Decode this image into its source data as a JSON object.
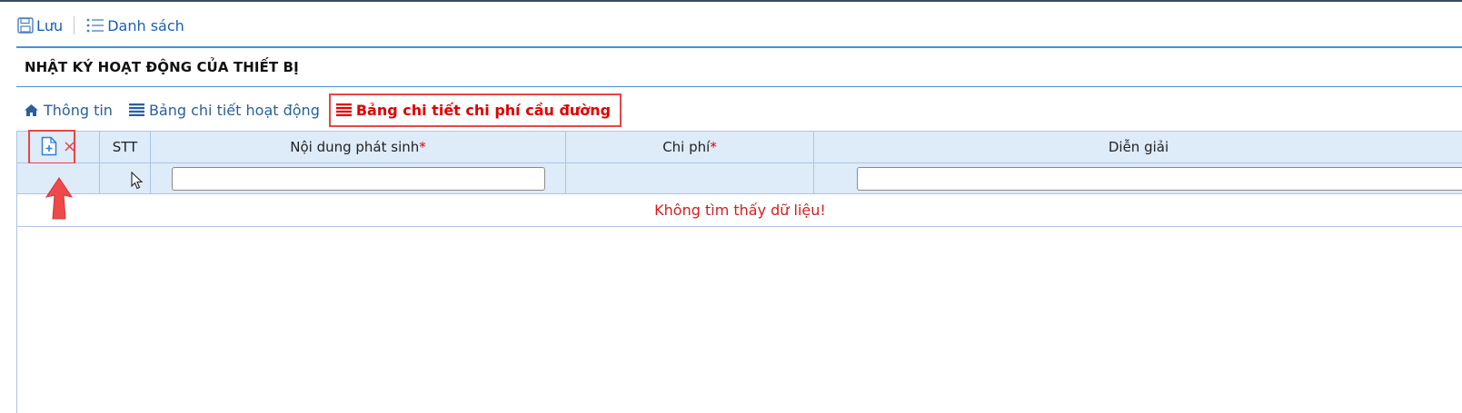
{
  "toolbar": {
    "save_label": "Lưu",
    "list_label": "Danh sách"
  },
  "page": {
    "title": "NHẬT KÝ HOẠT ĐỘNG CỦA THIẾT BỊ"
  },
  "tabs": [
    {
      "label": "Thông tin",
      "icon": "home-icon",
      "active": false
    },
    {
      "label": "Bảng chi tiết hoạt động",
      "icon": "list-icon",
      "active": false
    },
    {
      "label": "Bảng chi tiết chi phí cầu đường",
      "icon": "list-icon",
      "active": true
    }
  ],
  "grid": {
    "columns": [
      {
        "label": "",
        "required": false
      },
      {
        "label": "STT",
        "required": false
      },
      {
        "label": "Nội dung phát sinh",
        "required": true
      },
      {
        "label": "Chi phí",
        "required": true
      },
      {
        "label": "Diễn giải",
        "required": false
      }
    ],
    "required_mark": "*",
    "filters": {
      "noi_dung": "",
      "dien_giai": ""
    },
    "empty_message": "Không tìm thấy dữ liệu!",
    "delete_glyph": "×"
  },
  "colors": {
    "accent": "#1a5fb4",
    "required": "#e00000",
    "highlight": "#e94545",
    "header_bg": "#deebf8"
  }
}
